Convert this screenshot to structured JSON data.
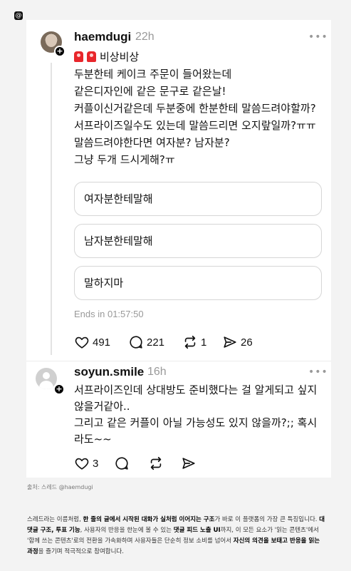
{
  "logo": {
    "icon": "threads-logo-icon",
    "glyph": "@"
  },
  "post": {
    "username": "haemdugi",
    "time": "22h",
    "more": "•••",
    "title_line": "비상비상",
    "lines": [
      "두분한테 케이크 주문이 들어왔는데",
      "같은디자인에 같은 문구로 같은날!",
      "커플이신거같은데 두분중에 한분한테 말씀드려야할까?",
      "서프라이즈일수도 있는데 말씀드리면 오지랖일까?ㅠㅠ",
      "말씀드려야한다면 여자분? 남자분?",
      "그냥 두개 드시게해?ㅠ"
    ],
    "poll_options": [
      "여자분한테말해",
      "남자분한테말해",
      "말하지마"
    ],
    "poll_status": "Ends in 01:57:50",
    "likes": "491",
    "comments": "221",
    "reposts": "1",
    "shares": "26"
  },
  "reply": {
    "username": "soyun.smile",
    "time": "16h",
    "more": "•••",
    "lines": [
      "서프라이즈인데 상대방도 준비했다는 걸 알게되고 싶지",
      "않을거같아..",
      "그리고 같은 커플이 아닐 가능성도 있지 않을까?;; 혹시",
      "라도~~"
    ],
    "likes": "3"
  },
  "source": "출처: 스레드 @haemdugi",
  "caption": {
    "p1": "스레드라는 이름처럼, ",
    "b1": "한 줄의 글에서 시작된 대화가 실처럼 이어지는 구조",
    "p2": "가 바로 이 플랫폼의 가장 큰 특징입니다. ",
    "b2": "대댓글 구조, 투표 기능",
    "p3": ", 사용자의 반응을 한눈에 볼 수 있는 ",
    "b3": "댓글 피드 노출 UI",
    "p4": "까지, 이 모든 요소가 '읽는 콘텐츠'에서 '함께 쓰는 콘텐츠'로의 전환을 가속화하며 사용자들은 단순히 정보 소비를 넘어서 ",
    "b4": "자신의 의견을 보태고 반응을 읽는 과정",
    "p5": "을 즐기며 적극적으로 참여합니다."
  }
}
